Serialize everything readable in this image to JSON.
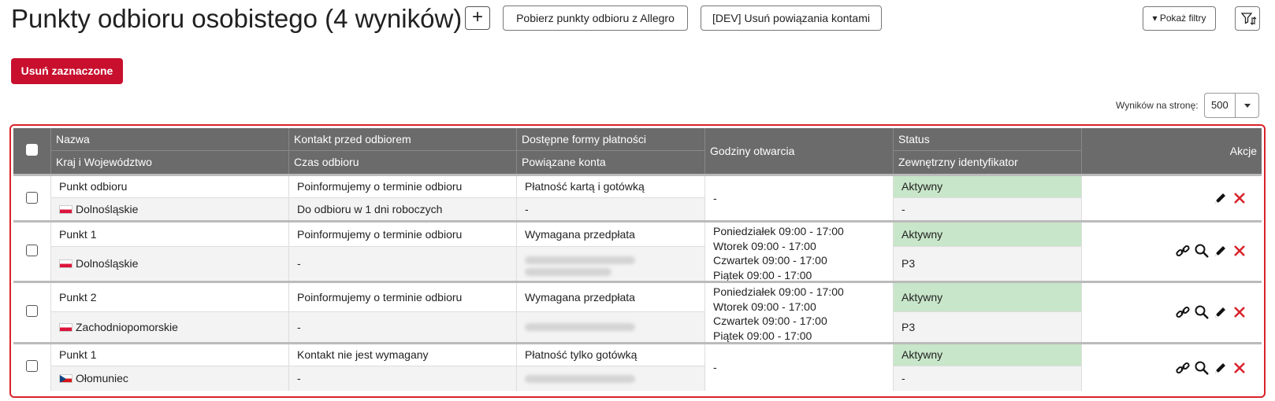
{
  "header": {
    "title": "Punkty odbioru osobistego (4 wyników)",
    "add_label": "+",
    "fetch_label": "Pobierz punkty odbioru z Allegro",
    "dev_label": "[DEV] Usuń powiązania kontami",
    "filters_label": "▾ Pokaż filtry"
  },
  "toolbar": {
    "delete_label": "Usuń zaznaczone"
  },
  "pagination": {
    "per_page_label": "Wyników na stronę:",
    "per_page_value": "500"
  },
  "table": {
    "headers": {
      "name": "Nazwa",
      "region": "Kraj i Województwo",
      "contact": "Kontakt przed odbiorem",
      "time": "Czas odbioru",
      "payment": "Dostępne formy płatności",
      "accounts": "Powiązane konta",
      "hours": "Godziny otwarcia",
      "status": "Status",
      "external_id": "Zewnętrzny identyfikator",
      "actions": "Akcje"
    },
    "rows": [
      {
        "name": "Punkt odbioru",
        "flag": "pl",
        "region": "Dolnośląskie",
        "contact": "Poinformujemy o terminie odbioru",
        "time": "Do odbioru w 1 dni roboczych",
        "payment": "Płatność kartą i gotówką",
        "accounts": "-",
        "hours": [
          "-"
        ],
        "status": "Aktywny",
        "external_id": "-",
        "actions": [
          "edit-icon",
          "delete-icon"
        ]
      },
      {
        "name": "Punkt 1",
        "flag": "pl",
        "region": "Dolnośląskie",
        "contact": "Poinformujemy o terminie odbioru",
        "time": "-",
        "payment": "Wymagana przedpłata",
        "accounts": "",
        "hours": [
          "Poniedziałek 09:00 - 17:00",
          "Wtorek 09:00 - 17:00",
          "Czwartek 09:00 - 17:00",
          "Piątek 09:00 - 17:00"
        ],
        "status": "Aktywny",
        "external_id": "P3",
        "actions": [
          "link-icon",
          "search-icon",
          "edit-icon",
          "delete-icon"
        ]
      },
      {
        "name": "Punkt 2",
        "flag": "pl",
        "region": "Zachodniopomorskie",
        "contact": "Poinformujemy o terminie odbioru",
        "time": "-",
        "payment": "Wymagana przedpłata",
        "accounts": "",
        "hours": [
          "Poniedziałek 09:00 - 17:00",
          "Wtorek 09:00 - 17:00",
          "Czwartek 09:00 - 17:00",
          "Piątek 09:00 - 17:00"
        ],
        "status": "Aktywny",
        "external_id": "P3",
        "actions": [
          "link-icon",
          "search-icon",
          "edit-icon",
          "delete-icon"
        ]
      },
      {
        "name": "Punkt 1",
        "flag": "cz",
        "region": "Ołomuniec",
        "contact": "Kontakt nie jest wymagany",
        "time": "-",
        "payment": "Płatność tylko gotówką",
        "accounts": "",
        "hours": [
          "-"
        ],
        "status": "Aktywny",
        "external_id": "-",
        "actions": [
          "link-icon",
          "search-icon",
          "edit-icon",
          "delete-icon"
        ]
      }
    ]
  },
  "colors": {
    "primary_red": "#c8102e",
    "header_bg": "#6b6b6b",
    "status_active_bg": "#c8e6c9",
    "frame_border": "#d9222a"
  }
}
